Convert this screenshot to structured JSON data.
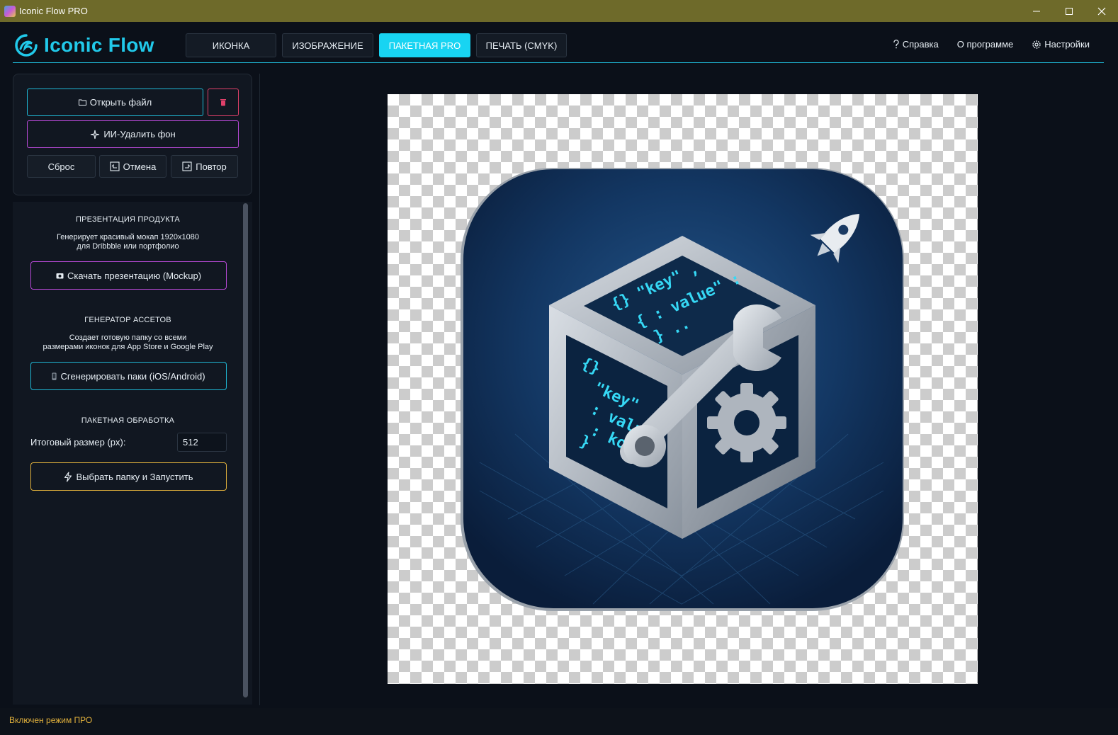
{
  "window": {
    "title": "Iconic Flow PRO"
  },
  "logo": {
    "text": "Iconic Flow"
  },
  "tabs": [
    {
      "label": "ИКОНКА"
    },
    {
      "label": "ИЗОБРАЖЕНИЕ"
    },
    {
      "label": "ПАКЕТНАЯ PRO",
      "active": true
    },
    {
      "label": "ПЕЧАТЬ (CMYK)"
    }
  ],
  "topnav": {
    "help": "Справка",
    "about": "О программе",
    "settings": "Настройки"
  },
  "toolbar": {
    "open_file": "Открыть файл",
    "ai_remove_bg": "ИИ-Удалить фон",
    "reset": "Сброс",
    "undo": "Отмена",
    "redo": "Повтор"
  },
  "presentation": {
    "title": "ПРЕЗЕНТАЦИЯ ПРОДУКТА",
    "desc_line1": "Генерирует красивый мокап 1920x1080",
    "desc_line2": "для Dribbble или портфолио",
    "button": "Скачать презентацию (Mockup)"
  },
  "assets": {
    "title": "ГЕНЕРАТОР АССЕТОВ",
    "desc_line1": "Создает готовую папку со всеми",
    "desc_line2": "размерами иконок для App Store и Google Play",
    "button": "Сгенерировать паки (iOS/Android)"
  },
  "batch": {
    "title": "ПАКЕТНАЯ ОБРАБОТКА",
    "size_label": "Итоговый размер (px):",
    "size_value": "512",
    "button": "Выбрать папку и Запустить"
  },
  "preview": {
    "code_top_1": "{} \"key\" ,",
    "code_top_2": "{ : value\" :",
    "code_top_3": "} ..",
    "code_left_1": "{}",
    "code_left_2": "\"key\"",
    "code_left_3": ": valu ,",
    "code_left_4": ": ko",
    "code_left_5": "}"
  },
  "status": {
    "text": "Включен режим ПРО"
  },
  "colors": {
    "accent": "#18d4f2",
    "purple": "#b94ad8",
    "danger": "#e0406a",
    "gold": "#e3b23c",
    "titlebar": "#6e6a2a"
  }
}
